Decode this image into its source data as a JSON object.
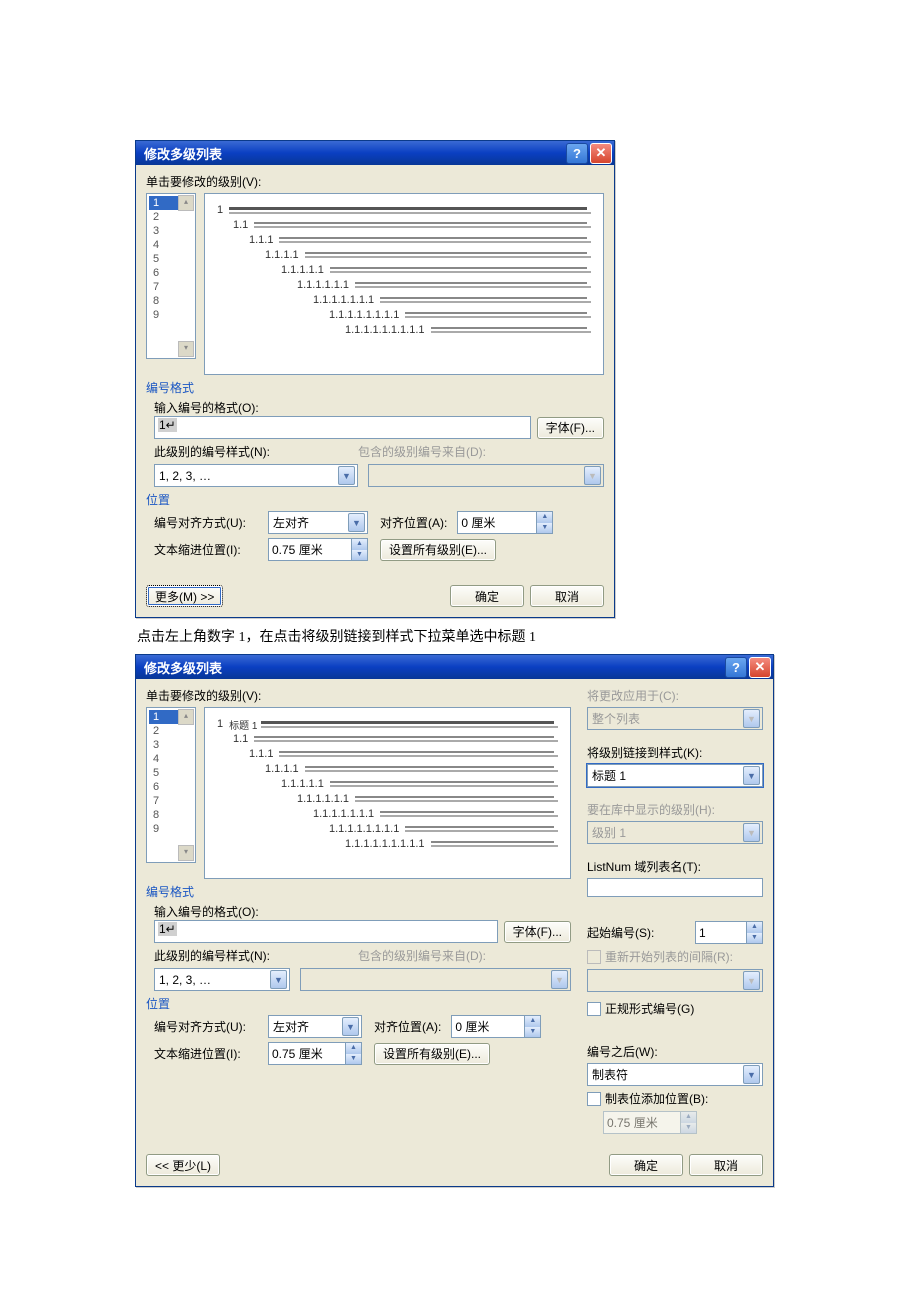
{
  "dialog1": {
    "title": "修改多级列表",
    "clickLevelLabel": "单击要修改的级别(V):",
    "levels": [
      "1",
      "2",
      "3",
      "4",
      "5",
      "6",
      "7",
      "8",
      "9"
    ],
    "preview": {
      "rows": [
        {
          "indent": 0,
          "num": "1"
        },
        {
          "indent": 1,
          "num": "1.1"
        },
        {
          "indent": 2,
          "num": "1.1.1"
        },
        {
          "indent": 3,
          "num": "1.1.1.1"
        },
        {
          "indent": 4,
          "num": "1.1.1.1.1"
        },
        {
          "indent": 5,
          "num": "1.1.1.1.1.1"
        },
        {
          "indent": 6,
          "num": "1.1.1.1.1.1.1"
        },
        {
          "indent": 7,
          "num": "1.1.1.1.1.1.1.1"
        },
        {
          "indent": 8,
          "num": "1.1.1.1.1.1.1.1.1"
        }
      ]
    },
    "numberFormat": {
      "title": "编号格式",
      "enterFormatLabel": "输入编号的格式(O):",
      "formatValue": "1↵",
      "fontBtn": "字体(F)...",
      "styleLabel": "此级别的编号样式(N):",
      "styleValue": "1, 2, 3, …",
      "includeFromLabel": "包含的级别编号来自(D):",
      "includeFromValue": ""
    },
    "position": {
      "title": "位置",
      "alignLabel": "编号对齐方式(U):",
      "alignValue": "左对齐",
      "alignAtLabel": "对齐位置(A):",
      "alignAtValue": "0 厘米",
      "indentLabel": "文本缩进位置(I):",
      "indentValue": "0.75 厘米",
      "setAllBtn": "设置所有级别(E)..."
    },
    "moreBtn": "更多(M) >>",
    "okBtn": "确定",
    "cancelBtn": "取消"
  },
  "middleText": "点击左上角数字 1，在点击将级别链接到样式下拉菜单选中标题 1",
  "dialog2": {
    "title": "修改多级列表",
    "clickLevelLabel": "单击要修改的级别(V):",
    "levels": [
      "1",
      "2",
      "3",
      "4",
      "5",
      "6",
      "7",
      "8",
      "9"
    ],
    "previewTag": "标题 1",
    "preview": {
      "rows": [
        {
          "indent": 0,
          "num": "1",
          "tag": "标题 1"
        },
        {
          "indent": 1,
          "num": "1.1"
        },
        {
          "indent": 2,
          "num": "1.1.1"
        },
        {
          "indent": 3,
          "num": "1.1.1.1"
        },
        {
          "indent": 4,
          "num": "1.1.1.1.1"
        },
        {
          "indent": 5,
          "num": "1.1.1.1.1.1"
        },
        {
          "indent": 6,
          "num": "1.1.1.1.1.1.1"
        },
        {
          "indent": 7,
          "num": "1.1.1.1.1.1.1.1"
        },
        {
          "indent": 8,
          "num": "1.1.1.1.1.1.1.1.1"
        }
      ]
    },
    "right": {
      "applyLabel": "将更改应用于(C):",
      "applyValue": "整个列表",
      "linkLabel": "将级别链接到样式(K):",
      "linkValue": "标题 1",
      "galleryLabel": "要在库中显示的级别(H):",
      "galleryValue": "级别 1",
      "listNumLabel": "ListNum 域列表名(T):",
      "listNumValue": "",
      "startLabel": "起始编号(S):",
      "startValue": "1",
      "restartLabel": "重新开始列表的间隔(R):",
      "legalLabel": "正规形式编号(G)",
      "followLabel": "编号之后(W):",
      "followValue": "制表符",
      "tabAddLabel": "制表位添加位置(B):",
      "tabAddValue": "0.75 厘米"
    },
    "numberFormat": {
      "title": "编号格式",
      "enterFormatLabel": "输入编号的格式(O):",
      "formatValue": "1↵",
      "fontBtn": "字体(F)...",
      "styleLabel": "此级别的编号样式(N):",
      "styleValue": "1, 2, 3, …",
      "includeFromLabel": "包含的级别编号来自(D):",
      "includeFromValue": ""
    },
    "position": {
      "title": "位置",
      "alignLabel": "编号对齐方式(U):",
      "alignValue": "左对齐",
      "alignAtLabel": "对齐位置(A):",
      "alignAtValue": "0 厘米",
      "indentLabel": "文本缩进位置(I):",
      "indentValue": "0.75 厘米",
      "setAllBtn": "设置所有级别(E)..."
    },
    "lessBtn": "<< 更少(L)",
    "okBtn": "确定",
    "cancelBtn": "取消"
  }
}
